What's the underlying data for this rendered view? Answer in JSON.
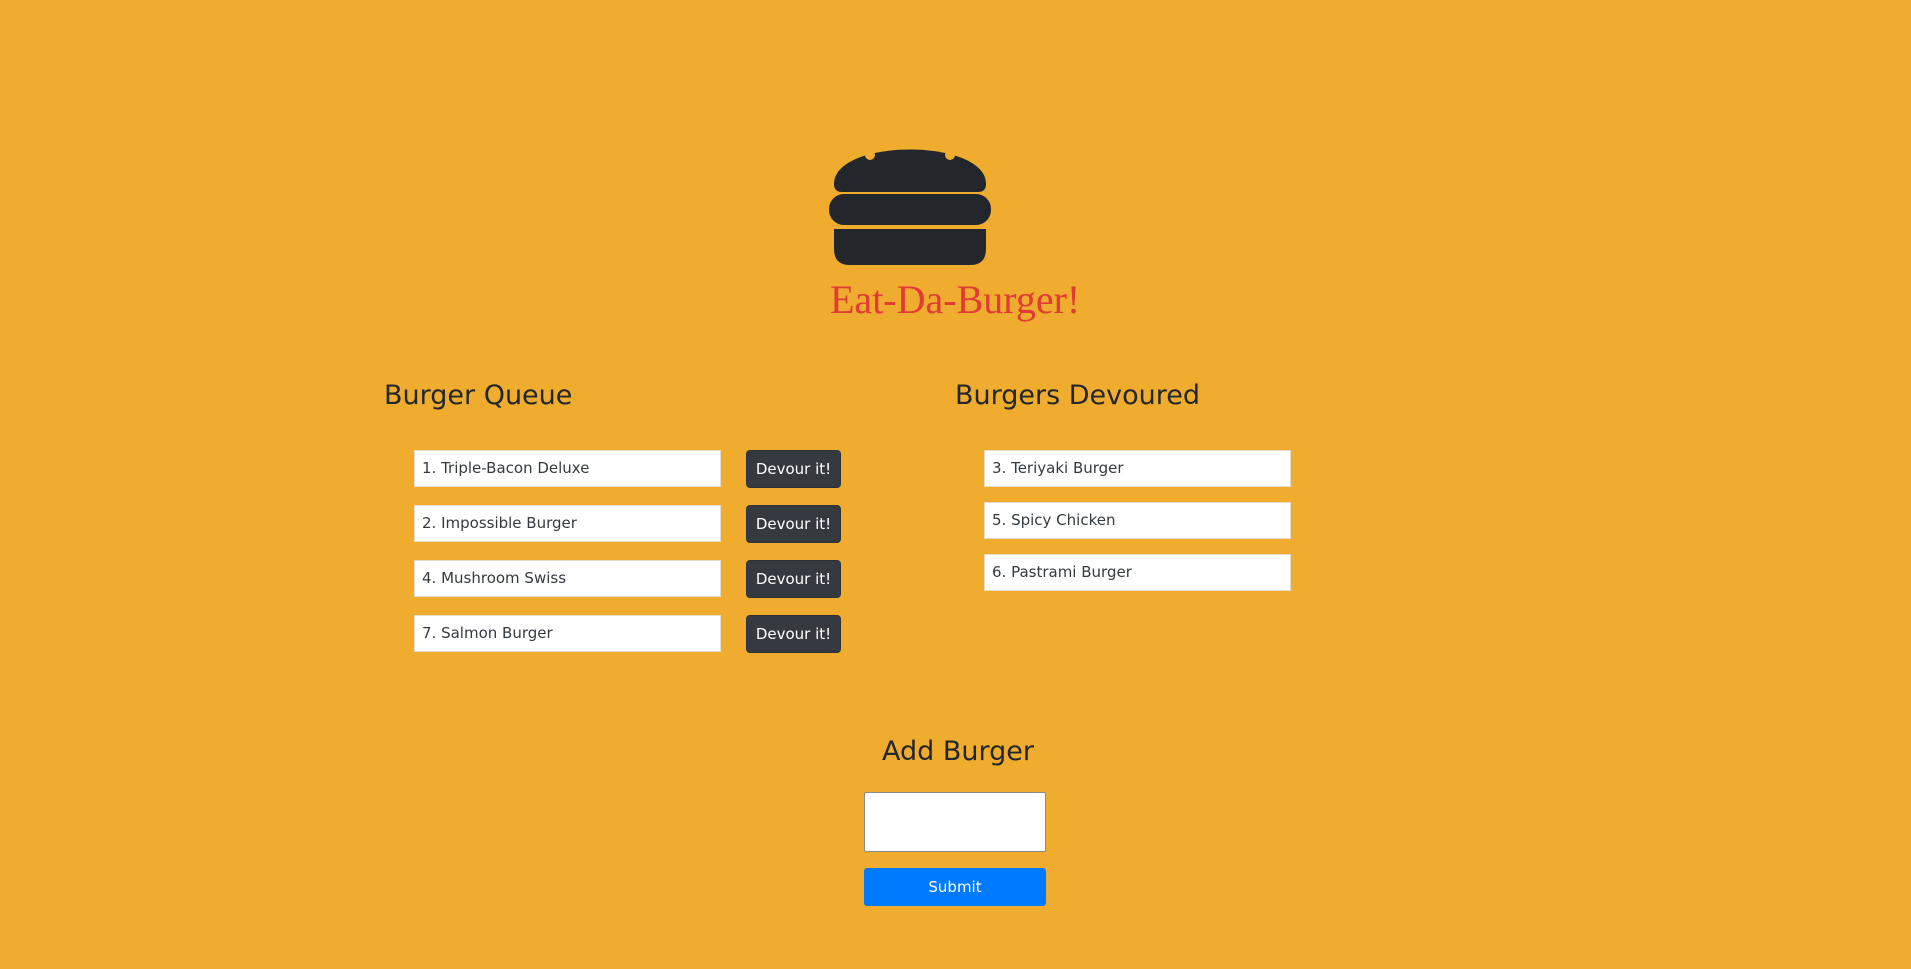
{
  "header": {
    "logo_icon": "hamburger-icon",
    "title": "Eat-Da-Burger!"
  },
  "queue": {
    "heading": "Burger Queue",
    "devour_label": "Devour it!",
    "items": [
      "1. Triple-Bacon Deluxe",
      "2. Impossible Burger",
      "4. Mushroom Swiss",
      "7. Salmon Burger"
    ]
  },
  "devoured": {
    "heading": "Burgers Devoured",
    "items": [
      "3. Teriyaki Burger",
      "5. Spicy Chicken",
      "6. Pastrami Burger"
    ]
  },
  "add_form": {
    "heading": "Add Burger",
    "input_value": "",
    "submit_label": "Submit"
  },
  "colors": {
    "background": "#f0ac2f",
    "title": "#e23a36",
    "dark": "#23272b",
    "devour_button": "#343a40",
    "submit_button": "#007bff"
  }
}
